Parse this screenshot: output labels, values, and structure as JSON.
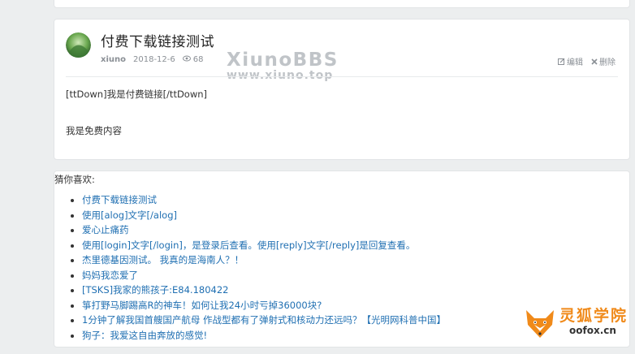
{
  "post": {
    "title": "付费下载链接测试",
    "author": "xiuno",
    "date": "2018-12-6",
    "views": "68",
    "edit_label": "编辑",
    "delete_label": "删除",
    "content_lines": [
      "[ttDown]我是付费链接[/ttDown]",
      "我是免费内容"
    ]
  },
  "watermark": {
    "line1": "XiunoBBS",
    "line2": "www.xiuno.top"
  },
  "recommend": {
    "title": "猜你喜欢:",
    "items": [
      "付费下载链接测试",
      "使用[alog]文字[/alog]",
      "爱心止痛药",
      "使用[login]文字[/login]，是登录后查看。使用[reply]文字[/reply]是回复查看。",
      "杰里德基因测试。 我真的是海南人？！",
      "妈妈我恋爱了",
      "[TSKS]我家的熊孩子:E84.180422",
      "箏打野马脚踢高R的神车！如何让我24小时亏掉36000块?",
      "1分钟了解我国首艘国产航母 作战型都有了弹射式和核动力还远吗？【光明网科普中国】",
      "狗子：我爱这自由奔放的感觉!"
    ]
  },
  "logo": {
    "cn": "灵狐学院",
    "en": "oofox.cn"
  }
}
